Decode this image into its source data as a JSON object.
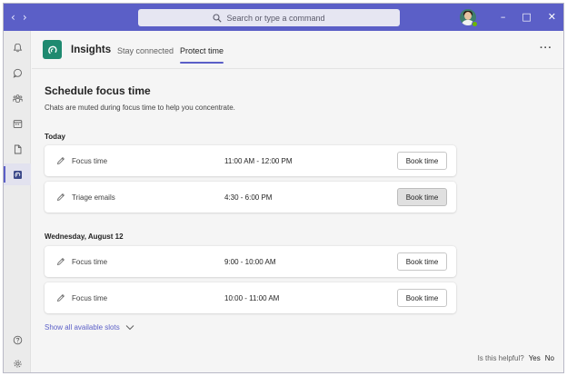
{
  "titlebar": {
    "back_icon": "chevron-left-icon",
    "forward_icon": "chevron-right-icon",
    "search_placeholder": "Search or type a command",
    "avatar_status": "available",
    "window_controls": [
      "minimize",
      "maximize",
      "close"
    ]
  },
  "rail": {
    "items": [
      {
        "icon": "bell-icon",
        "name": "activity"
      },
      {
        "icon": "chat-icon",
        "name": "chat"
      },
      {
        "icon": "teams-icon",
        "name": "teams"
      },
      {
        "icon": "calendar-icon",
        "name": "calendar"
      },
      {
        "icon": "files-icon",
        "name": "files"
      },
      {
        "icon": "insights-app-icon",
        "name": "insights",
        "active": true
      }
    ],
    "bottom_items": [
      {
        "icon": "help-icon",
        "name": "help"
      },
      {
        "icon": "settings-icon",
        "name": "settings"
      }
    ]
  },
  "header": {
    "app_name": "Insights",
    "tabs": [
      {
        "label": "Stay connected",
        "active": false
      },
      {
        "label": "Protect time",
        "active": true
      }
    ],
    "more_label": "···"
  },
  "main": {
    "title": "Schedule focus time",
    "subtitle": "Chats are muted during focus time to help you concentrate.",
    "days": [
      {
        "label": "Today",
        "slots": [
          {
            "name": "Focus time",
            "time": "11:00 AM - 12:00 PM",
            "button": "Book time",
            "hovered": false
          },
          {
            "name": "Triage emails",
            "time": "4:30 - 6:00 PM",
            "button": "Book time",
            "hovered": true
          }
        ]
      },
      {
        "label": "Wednesday, August 12",
        "slots": [
          {
            "name": "Focus time",
            "time": "9:00 - 10:00 AM",
            "button": "Book time",
            "hovered": false
          },
          {
            "name": "Focus time",
            "time": "10:00 - 11:00 AM",
            "button": "Book time",
            "hovered": false
          }
        ]
      }
    ],
    "show_all": "Show all available slots",
    "feedback": {
      "question": "Is this helpful?",
      "yes": "Yes",
      "no": "No"
    }
  },
  "colors": {
    "brand": "#5b5fc7",
    "app_icon": "#1f8a70",
    "background": "#f5f5f5",
    "card": "#ffffff"
  }
}
